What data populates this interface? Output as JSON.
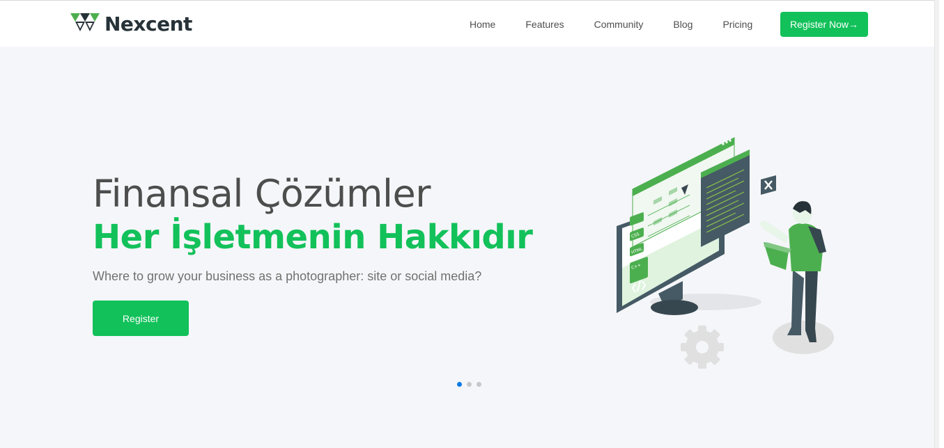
{
  "header": {
    "brand": "Nexcent",
    "nav": [
      {
        "label": "Home"
      },
      {
        "label": "Features"
      },
      {
        "label": "Community"
      },
      {
        "label": "Blog"
      },
      {
        "label": "Pricing"
      }
    ],
    "cta_label": "Register Now→"
  },
  "hero": {
    "title": "Finansal Çözümler",
    "title_accent": "Her İşletmenin Hakkıdır",
    "subtitle": "Where to grow your business as a photographer: site or social media?",
    "button_label": "Register",
    "slides": {
      "count": 3,
      "active_index": 0
    },
    "illustration": {
      "labels": [
        "CSS",
        "HTML",
        "C++"
      ]
    }
  },
  "colors": {
    "brand_green": "#12c15a",
    "heading_gray": "#4d4d4d",
    "text_gray": "#717171",
    "dark": "#263238",
    "hero_bg": "#f5f6f9",
    "dot_active": "#0a7ae6"
  },
  "icons": [
    "logo-icon",
    "arrow-right-icon",
    "close-icon",
    "gear-icon",
    "code-icon"
  ]
}
